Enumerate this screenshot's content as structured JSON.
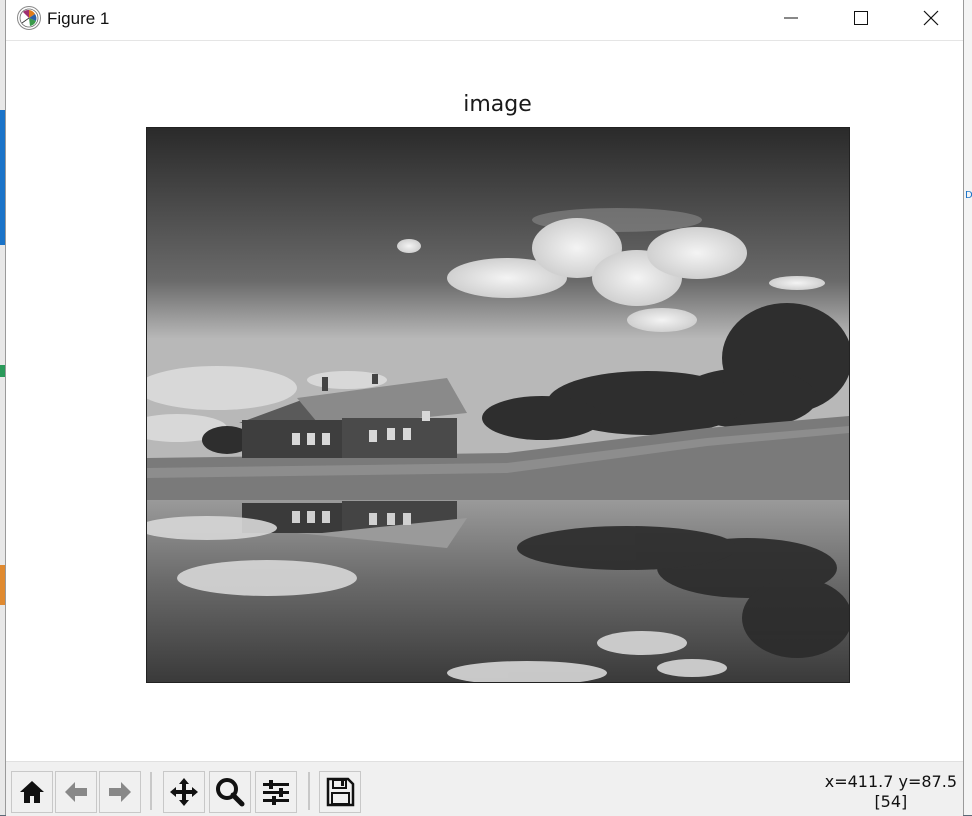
{
  "window": {
    "title": "Figure 1",
    "controls": {
      "minimize": "minimize",
      "maximize": "maximize",
      "close": "close"
    }
  },
  "figure": {
    "axes_title": "image",
    "image_description_icon": "grayscale-house-reflection-image"
  },
  "toolbar": {
    "buttons": [
      {
        "name": "home",
        "icon": "home-icon"
      },
      {
        "name": "back",
        "icon": "back-arrow-icon"
      },
      {
        "name": "forward",
        "icon": "forward-arrow-icon"
      },
      {
        "name": "pan",
        "icon": "move-icon"
      },
      {
        "name": "zoom",
        "icon": "magnifier-icon"
      },
      {
        "name": "configure-subplots",
        "icon": "sliders-icon"
      },
      {
        "name": "save",
        "icon": "floppy-disk-icon"
      }
    ],
    "coords_line1": "x=411.7 y=87.5",
    "coords_line2": "[54]"
  }
}
